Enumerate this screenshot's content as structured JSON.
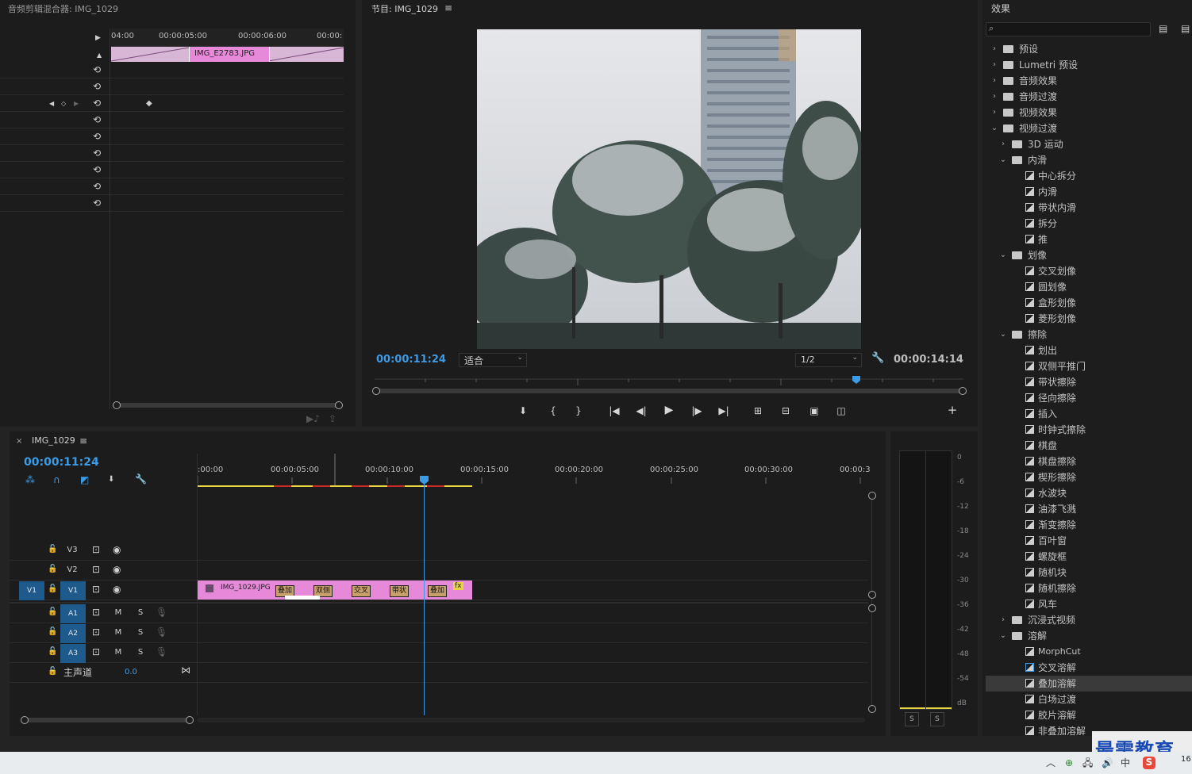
{
  "audio_mixer": {
    "title": "音频剪辑混合器: IMG_1029",
    "ruler": [
      "04:00",
      "00:00:05:00",
      "00:00:06:00",
      "00:00:"
    ],
    "clip_label": "IMG_E2783.JPG"
  },
  "program": {
    "title": "节目: IMG_1029",
    "timecode_current": "00:00:11:24",
    "fit_label": "适合",
    "quality_label": "1/2",
    "timecode_duration": "00:00:14:14"
  },
  "effects": {
    "title": "效果",
    "search_placeholder": "",
    "tree": [
      {
        "label": "预设",
        "level": 0,
        "type": "folder-preset",
        "expanded": false
      },
      {
        "label": "Lumetri 预设",
        "level": 0,
        "type": "folder-preset",
        "expanded": false
      },
      {
        "label": "音频效果",
        "level": 0,
        "type": "folder",
        "expanded": false
      },
      {
        "label": "音频过渡",
        "level": 0,
        "type": "folder",
        "expanded": false
      },
      {
        "label": "视频效果",
        "level": 0,
        "type": "folder",
        "expanded": false
      },
      {
        "label": "视频过渡",
        "level": 0,
        "type": "folder",
        "expanded": true
      },
      {
        "label": "3D 运动",
        "level": 1,
        "type": "folder",
        "expanded": false
      },
      {
        "label": "内滑",
        "level": 1,
        "type": "folder",
        "expanded": true
      },
      {
        "label": "中心拆分",
        "level": 2,
        "type": "effect"
      },
      {
        "label": "内滑",
        "level": 2,
        "type": "effect"
      },
      {
        "label": "带状内滑",
        "level": 2,
        "type": "effect"
      },
      {
        "label": "拆分",
        "level": 2,
        "type": "effect"
      },
      {
        "label": "推",
        "level": 2,
        "type": "effect"
      },
      {
        "label": "划像",
        "level": 1,
        "type": "folder",
        "expanded": true
      },
      {
        "label": "交叉划像",
        "level": 2,
        "type": "effect"
      },
      {
        "label": "圆划像",
        "level": 2,
        "type": "effect"
      },
      {
        "label": "盒形划像",
        "level": 2,
        "type": "effect"
      },
      {
        "label": "菱形划像",
        "level": 2,
        "type": "effect"
      },
      {
        "label": "擦除",
        "level": 1,
        "type": "folder",
        "expanded": true
      },
      {
        "label": "划出",
        "level": 2,
        "type": "effect"
      },
      {
        "label": "双侧平推门",
        "level": 2,
        "type": "effect"
      },
      {
        "label": "带状擦除",
        "level": 2,
        "type": "effect"
      },
      {
        "label": "径向擦除",
        "level": 2,
        "type": "effect"
      },
      {
        "label": "插入",
        "level": 2,
        "type": "effect"
      },
      {
        "label": "时钟式擦除",
        "level": 2,
        "type": "effect"
      },
      {
        "label": "棋盘",
        "level": 2,
        "type": "effect"
      },
      {
        "label": "棋盘擦除",
        "level": 2,
        "type": "effect"
      },
      {
        "label": "楔形擦除",
        "level": 2,
        "type": "effect"
      },
      {
        "label": "水波块",
        "level": 2,
        "type": "effect"
      },
      {
        "label": "油漆飞溅",
        "level": 2,
        "type": "effect"
      },
      {
        "label": "渐变擦除",
        "level": 2,
        "type": "effect"
      },
      {
        "label": "百叶窗",
        "level": 2,
        "type": "effect"
      },
      {
        "label": "螺旋框",
        "level": 2,
        "type": "effect"
      },
      {
        "label": "随机块",
        "level": 2,
        "type": "effect"
      },
      {
        "label": "随机擦除",
        "level": 2,
        "type": "effect"
      },
      {
        "label": "风车",
        "level": 2,
        "type": "effect"
      },
      {
        "label": "沉浸式视频",
        "level": 1,
        "type": "folder",
        "expanded": false
      },
      {
        "label": "溶解",
        "level": 1,
        "type": "folder",
        "expanded": true
      },
      {
        "label": "MorphCut",
        "level": 2,
        "type": "effect"
      },
      {
        "label": "交叉溶解",
        "level": 2,
        "type": "effect"
      },
      {
        "label": "叠加溶解",
        "level": 2,
        "type": "effect",
        "selected": true
      },
      {
        "label": "白场过渡",
        "level": 2,
        "type": "effect"
      },
      {
        "label": "胶片溶解",
        "level": 2,
        "type": "effect"
      },
      {
        "label": "非叠加溶解",
        "level": 2,
        "type": "effect"
      }
    ]
  },
  "timeline": {
    "tab": "IMG_1029",
    "timecode": "00:00:11:24",
    "ruler": [
      ":00:00",
      "00:00:05:00",
      "00:00:10:00",
      "00:00:15:00",
      "00:00:20:00",
      "00:00:25:00",
      "00:00:30:00",
      "00:00:3"
    ],
    "video_tracks": [
      "V3",
      "V2",
      "V1"
    ],
    "audio_tracks": [
      "A1",
      "A2",
      "A3"
    ],
    "source_patch": "V1",
    "mute_label": "M",
    "solo_label": "S",
    "master_label": "主声道",
    "master_value": "0.0",
    "clip_label": "IMG_1029.JPG",
    "transitions": [
      "叠加",
      "双侧",
      "交叉",
      "带状",
      "叠加"
    ],
    "fx_badge": "fx"
  },
  "meter": {
    "scale": [
      "0",
      "-6",
      "-12",
      "-18",
      "-24",
      "-30",
      "-36",
      "-42",
      "-48",
      "-54",
      "dB"
    ],
    "solo_buttons": [
      "S",
      "S"
    ]
  },
  "watermark": "最需教育",
  "taskbar": {
    "ime": "中",
    "clock": "16"
  },
  "colors": {
    "accent": "#3c9be6",
    "clip": "#e689d9",
    "transition": "#c8a06a"
  }
}
